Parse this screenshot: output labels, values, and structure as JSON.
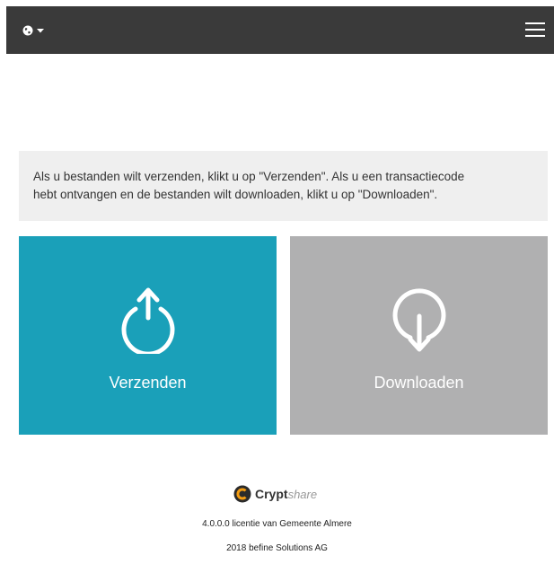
{
  "navbar": {
    "language_icon": "globe-icon",
    "caret_icon": "caret-down-icon",
    "menu_icon": "hamburger-menu-icon"
  },
  "info": {
    "text_line1": "Als u bestanden wilt verzenden, klikt u op \"Verzenden\". Als u een transactiecode",
    "text_line2": "hebt ontvangen en de bestanden wilt downloaden, klikt u op \"Downloaden\"."
  },
  "actions": {
    "send": {
      "label": "Verzenden",
      "icon": "upload-icon",
      "color": "#1aa0b9"
    },
    "download": {
      "label": "Downloaden",
      "icon": "download-icon",
      "color": "#b0b0b1"
    }
  },
  "footer": {
    "logo_bold": "Crypt",
    "logo_italic": "share",
    "license": "4.0.0.0 licentie van Gemeente Almere",
    "copyright": "2018 befine Solutions AG"
  }
}
